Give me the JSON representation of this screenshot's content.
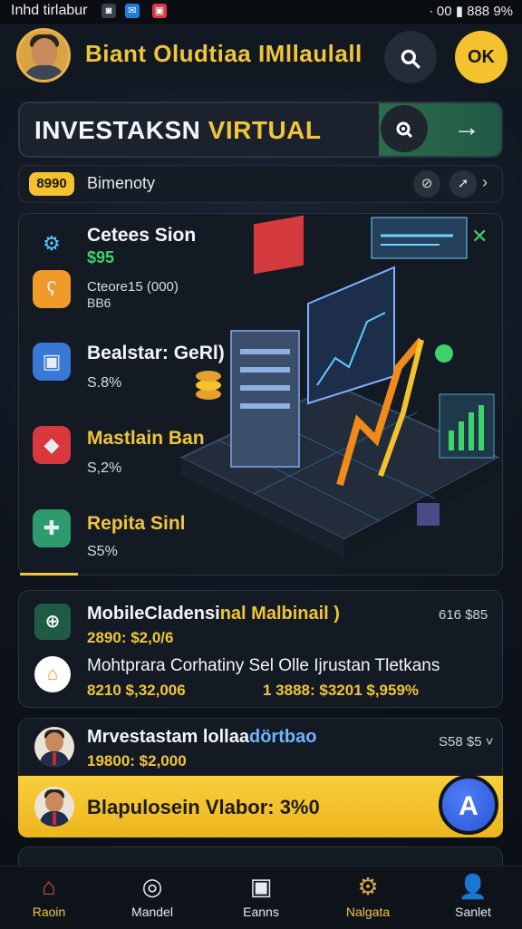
{
  "status_bar": {
    "carrier": "Inhd tirlabur",
    "right_text": "∙ 00 ▮ 888 9%"
  },
  "header": {
    "title": "Biant Oludtiaa IMllaulall",
    "action_label": "OK"
  },
  "hero": {
    "title_white": "INVESTAKSN ",
    "title_yellow": "VIRTUAL"
  },
  "filter": {
    "pill": "8990",
    "label": "Bimenoty"
  },
  "card": {
    "items": [
      {
        "name": "Cetees Sion",
        "value": "$95",
        "extra1": "Cteore15 (000)",
        "extra2": "BB6"
      },
      {
        "name": "Bealstar: GeRl)",
        "value": "S.8%"
      },
      {
        "name": "Mastlain Ban",
        "value": "S,2%"
      },
      {
        "name": "Repita Sinl",
        "value": "S5%"
      }
    ]
  },
  "list": {
    "row1": {
      "title_white": "MobileCladensi",
      "title_yellow": "nal Malbinail )",
      "sub": "2890: $2,0/6",
      "right": "616 $85"
    },
    "row2": {
      "title": "Mohtprara Corhatiny Sel Olle Ijrustan Tletkans",
      "sub": "8210 $,32,006",
      "sub_right": "1 3888: $3201 $,959%"
    },
    "row3": {
      "title_white": "Mrvestastam lollaa",
      "title_blue": "dörtbao",
      "sub": "19800: $2,000",
      "right": "S58 $5 ˅"
    }
  },
  "banner": {
    "text": "Blapulosein Vlabor: 3%0"
  },
  "nav": [
    {
      "label": "Raoin"
    },
    {
      "label": "Mandel"
    },
    {
      "label": "Eanns"
    },
    {
      "label": "Nalgata"
    },
    {
      "label": "Sanlet"
    }
  ],
  "colors": {
    "accent": "#f0c53b",
    "green": "#3fd16b",
    "blue": "#2a56d6",
    "bg": "#0e131c"
  }
}
